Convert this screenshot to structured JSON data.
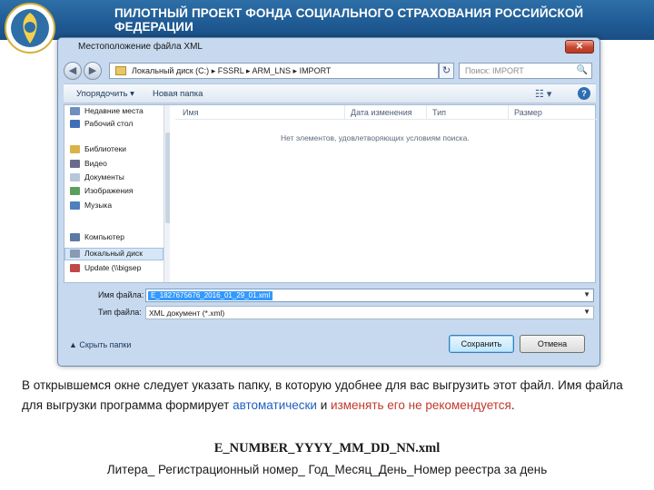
{
  "slide": {
    "banner_title": "ПИЛОТНЫЙ ПРОЕКТ ФОНДА СОЦИАЛЬНОГО СТРАХОВАНИЯ РОССИЙСКОЙ ФЕДЕРАЦИИ",
    "logo": "fss-emblem"
  },
  "dialog": {
    "title": "Местоположение файла XML",
    "close_glyph": "✕",
    "back_glyph": "◀",
    "forward_glyph": "▶",
    "address_segments": [
      "Локальный диск (C:)",
      "FSSRL",
      "ARM_LNS",
      "IMPORT"
    ],
    "address_separator": "▸",
    "refresh_glyph": "↻",
    "search_placeholder": "Поиск: IMPORT",
    "search_glyph": "🔍",
    "toolbar": {
      "organize": "Упорядочить ▾",
      "new_folder": "Новая папка",
      "view_glyph": "☷ ▾",
      "help_glyph": "?"
    },
    "tree": [
      {
        "label": "Недавние места",
        "icon": "recent-places-icon"
      },
      {
        "label": "Рабочий стол",
        "icon": "desktop-icon"
      },
      {
        "label": "Библиотеки",
        "icon": "libraries-icon"
      },
      {
        "label": "Видео",
        "icon": "video-icon"
      },
      {
        "label": "Документы",
        "icon": "documents-icon"
      },
      {
        "label": "Изображения",
        "icon": "images-icon"
      },
      {
        "label": "Музыка",
        "icon": "music-icon"
      },
      {
        "label": "Компьютер",
        "icon": "computer-icon"
      },
      {
        "label": "Локальный диск",
        "icon": "drive-icon"
      },
      {
        "label": "Update (\\\\bigsep",
        "icon": "network-drive-icon"
      }
    ],
    "columns": [
      "Имя",
      "Дата изменения",
      "Тип",
      "Размер"
    ],
    "empty_message": "Нет элементов, удовлетворяющих условиям поиска.",
    "filename_label": "Имя файла:",
    "filename_value": "E_1827675676_2016_01_29_01.xml",
    "filetype_label": "Тип файла:",
    "filetype_value": "XML документ (*.xml)",
    "dropdown_glyph": "▼",
    "hide_folders": "▲ Скрыть папки",
    "save_button": "Сохранить",
    "cancel_button": "Отмена"
  },
  "caption": {
    "part1": "В открывшемся окне следует указать папку, в которую удобнее для вас выгрузить этот файл. Имя файла для выгрузки программа формирует ",
    "part2_blue": "автоматически",
    "part3": " и ",
    "part4_red": "изменять его не рекомендуется",
    "part5": "."
  },
  "file_pattern": "E_NUMBER_YYYY_MM_DD_NN.xml",
  "pattern_legend": "Литера_ Регистрационный номер_ Год_Месяц_День_Номер реестра за день",
  "colors": {
    "banner": "#1f5a93",
    "highlight_blue": "#1f5fbf",
    "highlight_red": "#c0392b",
    "selection": "#3399ff"
  }
}
